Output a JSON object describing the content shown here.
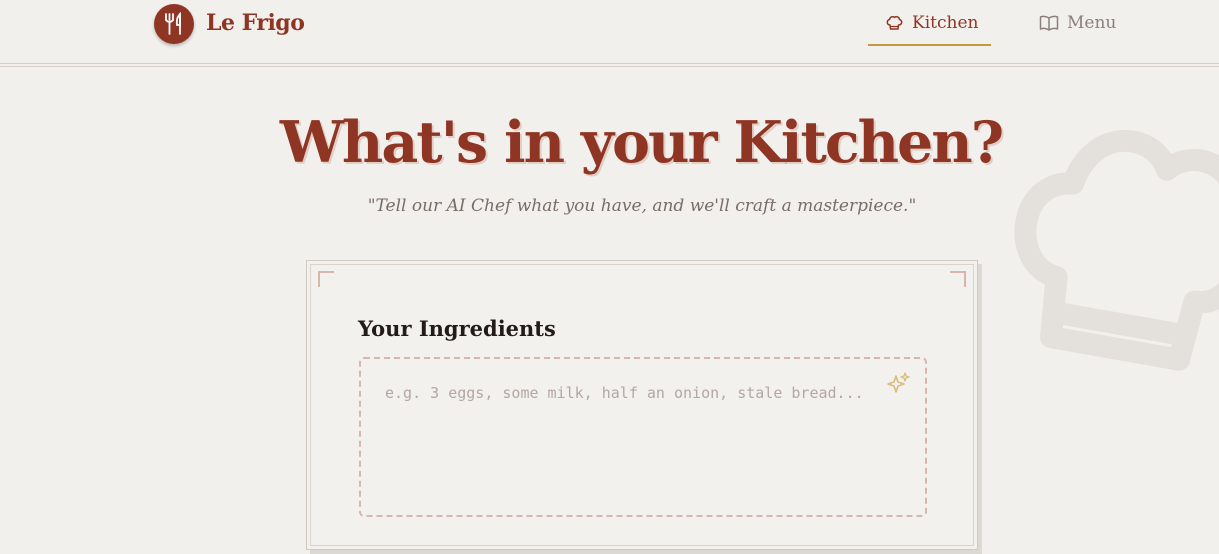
{
  "app": {
    "brand": "Le Frigo",
    "logo_icon": "fork-knife-icon",
    "accent_color": "#8f3524",
    "gold_color": "#c59a3e"
  },
  "nav": {
    "items": [
      {
        "label": "Kitchen",
        "icon": "chef-hat-icon",
        "active": true
      },
      {
        "label": "Menu",
        "icon": "open-book-icon",
        "active": false
      }
    ]
  },
  "hero": {
    "title": "What's in your Kitchen?",
    "subtitle": "\"Tell our AI Chef what you have, and we'll craft a masterpiece.\"",
    "background_icon": "chef-hat-icon"
  },
  "form": {
    "ingredients_label": "Your Ingredients",
    "ingredients_placeholder": "e.g. 3 eggs, some milk, half an onion, stale bread...",
    "ingredients_value": "",
    "sparkle_icon": "sparkles-icon"
  }
}
